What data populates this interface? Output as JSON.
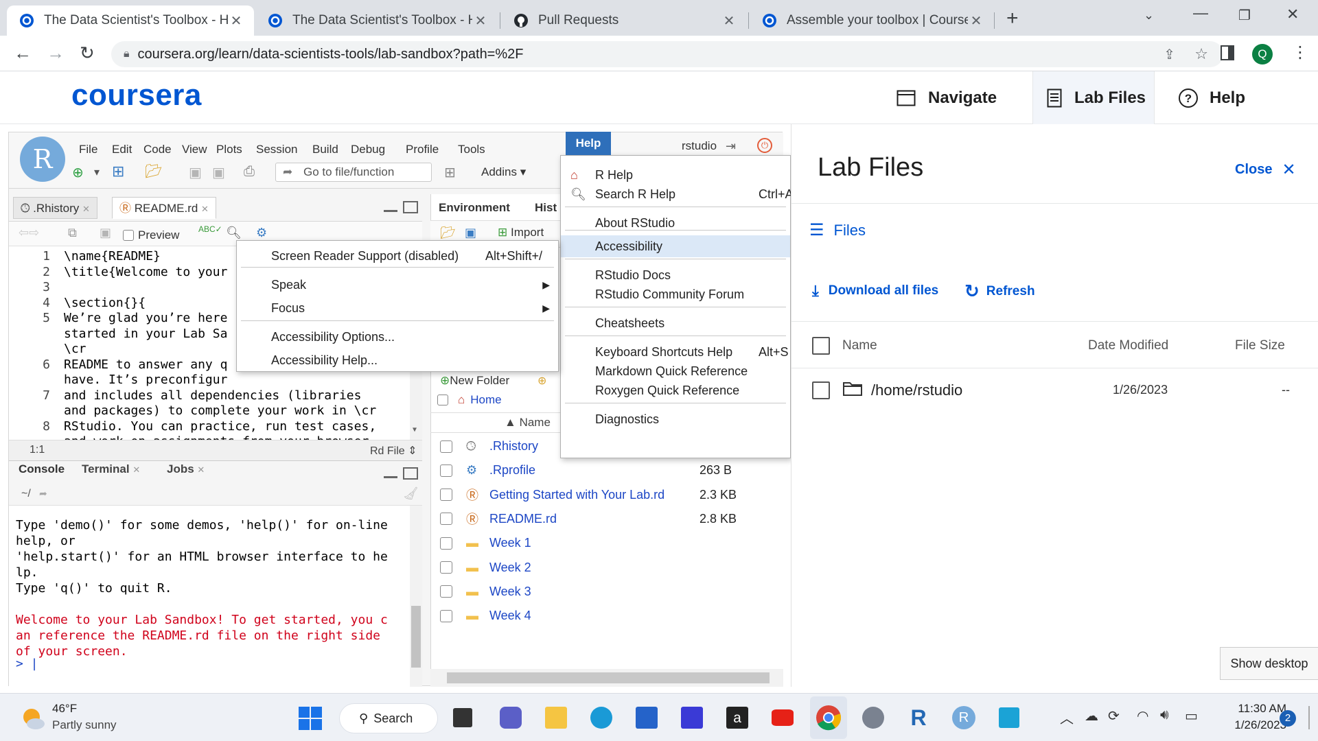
{
  "browser": {
    "tabs": [
      {
        "title": "The Data Scientist's Toolbox - Ho",
        "active": true
      },
      {
        "title": "The Data Scientist's Toolbox - Ho",
        "active": false
      },
      {
        "title": "Pull Requests",
        "active": false
      },
      {
        "title": "Assemble your toolbox | Courser",
        "active": false
      }
    ],
    "url": "coursera.org/learn/data-scientists-tools/lab-sandbox?path=%2F",
    "profile_initial": "Q"
  },
  "coursera": {
    "logo": "coursera",
    "navigate_label": "Navigate",
    "lab_files_label": "Lab Files",
    "help_label": "Help"
  },
  "rstudio": {
    "avatar_letter": "R",
    "menu": [
      "File",
      "Edit",
      "Code",
      "View",
      "Plots",
      "Session",
      "Build",
      "Debug",
      "Profile",
      "Tools",
      "Help"
    ],
    "user": "rstudio",
    "goto_placeholder": "Go to file/function",
    "addins_label": "Addins",
    "editor": {
      "tabs": [
        ".Rhistory",
        "README.rd"
      ],
      "preview_label": "Preview",
      "lines": [
        {
          "no": "1",
          "text": "\\name{README}"
        },
        {
          "no": "2",
          "text": "\\title{Welcome to your"
        },
        {
          "no": "3",
          "text": ""
        },
        {
          "no": "4",
          "text": "\\section{}{"
        },
        {
          "no": "5",
          "text": "We’re glad you’re here"
        },
        {
          "no": "",
          "text": "started in your Lab Sa"
        },
        {
          "no": "",
          "text": "\\cr"
        },
        {
          "no": "6",
          "text": "README to answer any q"
        },
        {
          "no": "",
          "text": "have. It’s preconfigur"
        },
        {
          "no": "7",
          "text": "and includes all dependencies (libraries"
        },
        {
          "no": "",
          "text": "and packages) to complete your work in \\cr"
        },
        {
          "no": "8",
          "text": "RStudio. You can practice, run test cases,"
        },
        {
          "no": "",
          "text": "and work on assignments from your browser"
        }
      ],
      "position": "1:1",
      "file_type": "Rd File"
    },
    "console": {
      "tabs": [
        "Console",
        "Terminal",
        "Jobs"
      ],
      "path": "~/",
      "lines": [
        {
          "text": "Type 'demo()' for some demos, 'help()' for on-line",
          "red": false
        },
        {
          "text": "help, or",
          "red": false
        },
        {
          "text": "'help.start()' for an HTML browser interface to he",
          "red": false
        },
        {
          "text": "lp.",
          "red": false
        },
        {
          "text": "Type 'q()' to quit R.",
          "red": false
        },
        {
          "text": "",
          "red": false
        },
        {
          "text": "Welcome to your Lab Sandbox! To get started, you c",
          "red": true
        },
        {
          "text": "an reference the README.rd file on the right side",
          "red": true
        },
        {
          "text": "of your screen.",
          "red": true
        }
      ],
      "prompt": ">"
    },
    "env": {
      "tabs": [
        "Environment",
        "Hist"
      ],
      "import_label": "Import",
      "new_folder_label": "New Folder",
      "home_label": "Home",
      "name_header": "Name",
      "files": [
        {
          "name": ".Rhistory",
          "size": "",
          "icon": "history-icon"
        },
        {
          "name": ".Rprofile",
          "size": "263 B",
          "icon": "gear-icon"
        },
        {
          "name": "Getting Started with Your Lab.rd",
          "size": "2.3 KB",
          "icon": "rd-file-icon"
        },
        {
          "name": "README.rd",
          "size": "2.8 KB",
          "icon": "rd-file-icon"
        },
        {
          "name": "Week 1",
          "size": "",
          "icon": "folder-icon"
        },
        {
          "name": "Week 2",
          "size": "",
          "icon": "folder-icon"
        },
        {
          "name": "Week 3",
          "size": "",
          "icon": "folder-icon"
        },
        {
          "name": "Week 4",
          "size": "",
          "icon": "folder-icon"
        }
      ]
    },
    "help_menu": [
      {
        "label": "R Help",
        "shortcut": "",
        "icon": "home-icon"
      },
      {
        "label": "Search R Help",
        "shortcut": "Ctrl+A",
        "icon": "search-icon"
      },
      {
        "label": "About RStudio",
        "shortcut": ""
      },
      {
        "label": "Accessibility",
        "shortcut": "",
        "highlighted": true
      },
      {
        "label": "RStudio Docs",
        "shortcut": ""
      },
      {
        "label": "RStudio Community Forum",
        "shortcut": ""
      },
      {
        "label": "Cheatsheets",
        "shortcut": ""
      },
      {
        "label": "Keyboard Shortcuts Help",
        "shortcut": "Alt+S"
      },
      {
        "label": "Markdown Quick Reference",
        "shortcut": ""
      },
      {
        "label": "Roxygen Quick Reference",
        "shortcut": ""
      },
      {
        "label": "Diagnostics",
        "shortcut": ""
      }
    ],
    "accessibility_menu": [
      {
        "label": "Screen Reader Support (disabled)",
        "shortcut": "Alt+Shift+/"
      },
      {
        "label": "Speak",
        "shortcut": ""
      },
      {
        "label": "Focus",
        "shortcut": ""
      },
      {
        "label": "Accessibility Options...",
        "shortcut": ""
      },
      {
        "label": "Accessibility Help...",
        "shortcut": ""
      }
    ]
  },
  "lab_files": {
    "title": "Lab Files",
    "close_label": "Close",
    "files_label": "Files",
    "download_label": "Download all files",
    "refresh_label": "Refresh",
    "col_name": "Name",
    "col_date": "Date Modified",
    "col_size": "File Size",
    "rows": [
      {
        "name": "/home/rstudio",
        "date": "1/26/2023",
        "size": "--"
      }
    ],
    "show_desktop": "Show desktop"
  },
  "taskbar": {
    "temp": "46°F",
    "weather": "Partly sunny",
    "search_label": "Search",
    "time": "11:30 AM",
    "date": "1/26/2023",
    "notifications": "2"
  }
}
